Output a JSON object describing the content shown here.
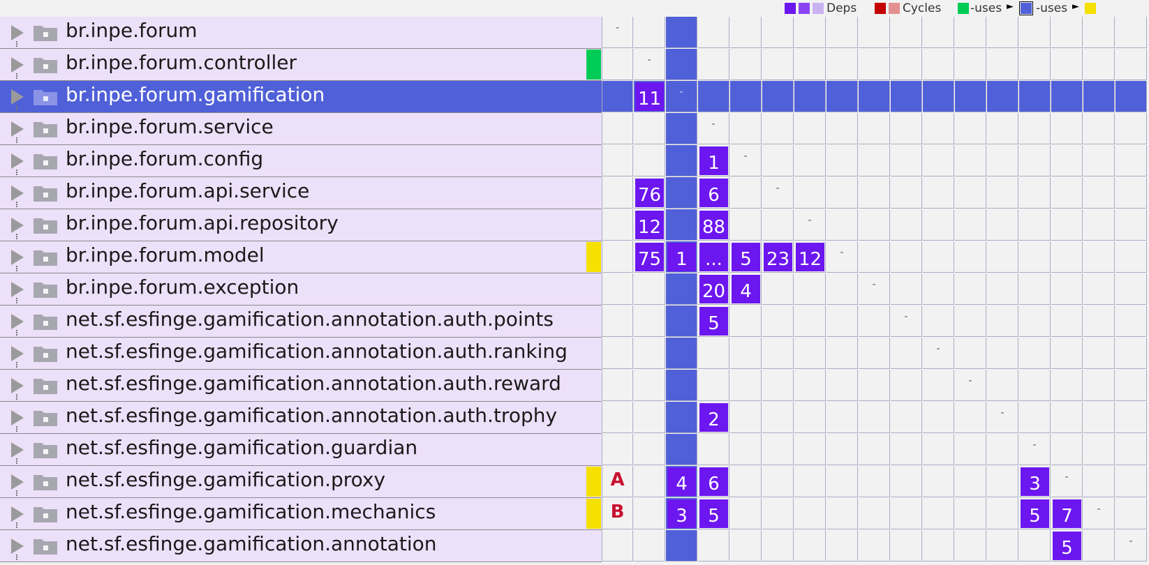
{
  "legend": {
    "deps_label": "Deps",
    "cycles_label": "Cycles",
    "uses_label_1": "-uses",
    "uses_label_2": "-uses",
    "colors": {
      "deps_dark": "#6c16f0",
      "deps_mid": "#8a44f4",
      "deps_light": "#c9b2f2",
      "cycles_dark": "#c40000",
      "cycles_light": "#e39090",
      "uses_green": "#00cc55",
      "uses_blue": "#5060d8",
      "uses_yellow": "#f5e000"
    }
  },
  "colors": {
    "name_bg": "#ede0f9",
    "selection": "#5060d8",
    "badge": "#6c16f0",
    "marker_green": "#00cc55",
    "marker_yellow": "#f5e000",
    "letter": "#c8102e"
  },
  "selected_index": 2,
  "packages": [
    {
      "name": "br.inpe.forum",
      "marker": null,
      "cells": {
        "0": "-"
      }
    },
    {
      "name": "br.inpe.forum.controller",
      "marker": "green",
      "cells": {
        "1": "-"
      }
    },
    {
      "name": "br.inpe.forum.gamification",
      "marker": null,
      "cells": {
        "1": "11",
        "2": "-"
      }
    },
    {
      "name": "br.inpe.forum.service",
      "marker": null,
      "cells": {
        "3": "-"
      }
    },
    {
      "name": "br.inpe.forum.config",
      "marker": null,
      "cells": {
        "3": "1",
        "4": "-"
      }
    },
    {
      "name": "br.inpe.forum.api.service",
      "marker": null,
      "cells": {
        "1": "76",
        "3": "6",
        "5": "-"
      }
    },
    {
      "name": "br.inpe.forum.api.repository",
      "marker": null,
      "cells": {
        "1": "12",
        "3": "88",
        "6": "-"
      }
    },
    {
      "name": "br.inpe.forum.model",
      "marker": "yellow",
      "cells": {
        "1": "75",
        "2": "1",
        "3": "...",
        "4": "5",
        "5": "23",
        "6": "12",
        "7": "-"
      }
    },
    {
      "name": "br.inpe.forum.exception",
      "marker": null,
      "cells": {
        "3": "20",
        "4": "4",
        "8": "-"
      }
    },
    {
      "name": "net.sf.esfinge.gamification.annotation.auth.points",
      "marker": null,
      "cells": {
        "3": "5",
        "9": "-"
      }
    },
    {
      "name": "net.sf.esfinge.gamification.annotation.auth.ranking",
      "marker": null,
      "cells": {
        "10": "-"
      }
    },
    {
      "name": "net.sf.esfinge.gamification.annotation.auth.reward",
      "marker": null,
      "cells": {
        "11": "-"
      }
    },
    {
      "name": "net.sf.esfinge.gamification.annotation.auth.trophy",
      "marker": null,
      "cells": {
        "3": "2",
        "12": "-"
      }
    },
    {
      "name": "net.sf.esfinge.gamification.guardian",
      "marker": null,
      "cells": {
        "13": "-"
      }
    },
    {
      "name": "net.sf.esfinge.gamification.proxy",
      "marker": "yellow",
      "letter": "A",
      "cells": {
        "2": "4",
        "3": "6",
        "13": "3",
        "14": "-"
      }
    },
    {
      "name": "net.sf.esfinge.gamification.mechanics",
      "marker": "yellow",
      "letter": "B",
      "cells": {
        "2": "3",
        "3": "5",
        "13": "5",
        "14": "7",
        "15": "-"
      }
    },
    {
      "name": "net.sf.esfinge.gamification.annotation",
      "marker": null,
      "cells": {
        "14": "5",
        "16": "-"
      }
    }
  ]
}
